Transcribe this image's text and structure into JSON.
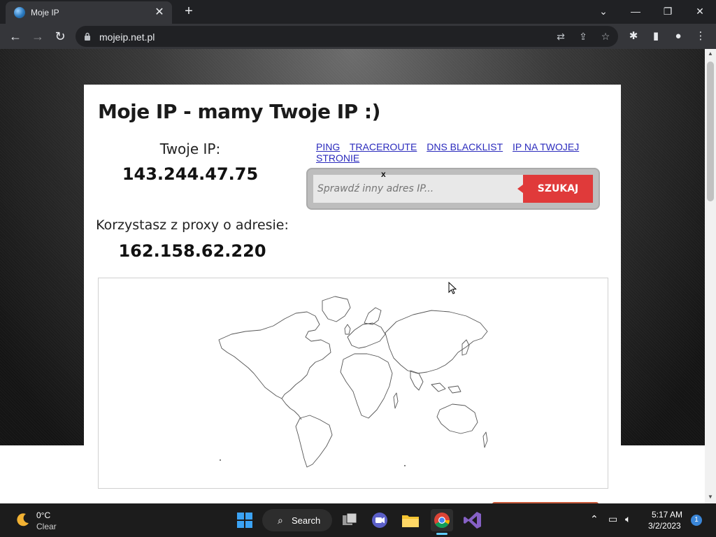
{
  "browser": {
    "tab_title": "Moje IP",
    "url": "mojeip.net.pl",
    "close_tab_glyph": "✕",
    "new_tab_glyph": "+",
    "icons": [
      "globe-icon",
      "back-icon",
      "forward-icon",
      "reload-icon",
      "lock-icon",
      "translate-icon",
      "share-icon",
      "star-icon",
      "extensions-icon",
      "sidebar-icon",
      "profile-icon",
      "menu-icon"
    ]
  },
  "window_controls": {
    "tabsearch": "⌄",
    "minimize": "—",
    "restore": "❐",
    "close": "✕"
  },
  "page": {
    "title": "Moje IP - mamy Twoje IP :)",
    "your_ip_label": "Twoje IP:",
    "your_ip": "143.244.47.75",
    "proxy_label": "Korzystasz z proxy o adresie:",
    "proxy_ip": "162.158.62.220",
    "links": [
      "PING",
      "TRACEROUTE",
      "DNS BLACKLIST",
      "IP NA TWOJEJ STRONIE"
    ],
    "search": {
      "placeholder": "Sprawdź inny adres IP...",
      "button": "SZUKAJ",
      "clear": "x"
    }
  },
  "taskbar": {
    "weather_temp": "0°C",
    "weather_condition": "Clear",
    "search_label": "Search",
    "time": "5:17 AM",
    "date": "3/2/2023",
    "notification_count": "1",
    "apps": [
      "windows-start-icon",
      "search-icon",
      "task-view-icon",
      "meet-icon",
      "file-explorer-icon",
      "chrome-icon",
      "visual-studio-icon"
    ],
    "accent": "#60cdff"
  },
  "colors": {
    "search_button": "#e03a3a",
    "link": "#2b2bbd"
  }
}
